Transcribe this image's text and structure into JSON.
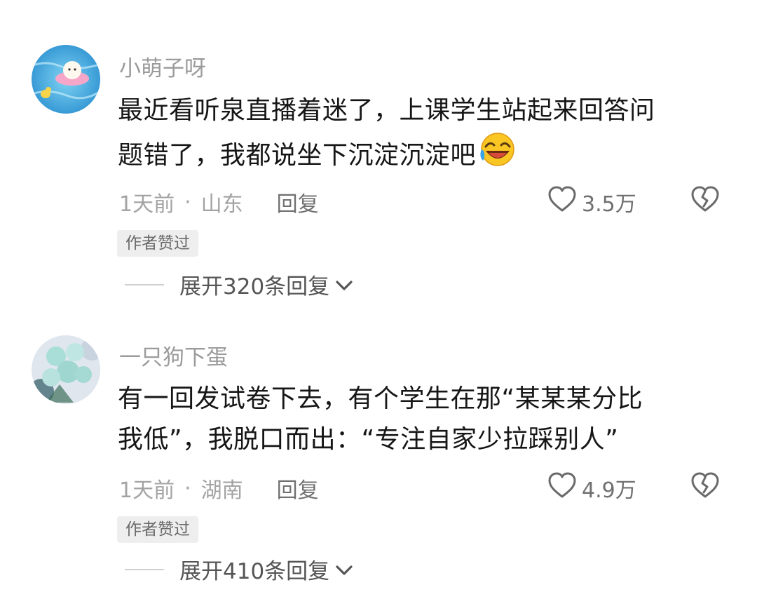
{
  "comments": [
    {
      "username": "小萌子呀",
      "text_line1": "最近看听泉直播着迷了，上课学生站起来回答问",
      "text_line2": "题错了，我都说坐下沉淀沉淀吧",
      "emoji": "laughing-crying-emoji",
      "time": "1天前",
      "location": "山东",
      "reply_label": "回复",
      "likes": "3.5万",
      "badge": "作者赞过",
      "expand_label": "展开320条回复"
    },
    {
      "username": "一只狗下蛋",
      "text_line1": "有一回发试卷下去，有个学生在那“某某某分比",
      "text_line2": "我低”，我脱口而出：“专注自家少拉踩别人”",
      "time": "1天前",
      "location": "湖南",
      "reply_label": "回复",
      "likes": "4.9万",
      "badge": "作者赞过",
      "expand_label": "展开410条回复"
    }
  ],
  "separator": "·",
  "icons": {
    "like": "heart-icon",
    "dislike": "broken-heart-icon",
    "expand": "chevron-down-icon"
  },
  "colors": {
    "username": "#9b9b9b",
    "text": "#161616",
    "meta": "#a3a3a3",
    "badge_bg": "#eeeeee"
  }
}
